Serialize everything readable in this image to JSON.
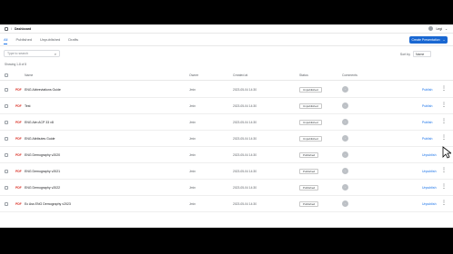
{
  "header": {
    "breadcrumb": [
      "Dashboard"
    ],
    "user_name": "Legi"
  },
  "tabs": [
    {
      "label": "All",
      "active": true
    },
    {
      "label": "Published",
      "active": false
    },
    {
      "label": "Unpublished",
      "active": false
    },
    {
      "label": "Drafts",
      "active": false
    }
  ],
  "create_button": {
    "label": "Create Presentation",
    "icon": "chevron-down-icon"
  },
  "search": {
    "placeholder": "Type to search",
    "icon": "search-icon"
  },
  "sort": {
    "label": "Sort by",
    "value": "Name"
  },
  "showing_text": "Showing 1-8 of 8",
  "table": {
    "columns": [
      "Name",
      "Owner",
      "Created at",
      "Status",
      "Comments"
    ],
    "rows": [
      {
        "tag": "PDF",
        "name": "ENG Abbreviations Guide",
        "owner": "Jmin",
        "date": "2023-05-04 14:30",
        "status": "Unpublished",
        "action": "Publish"
      },
      {
        "tag": "PDF",
        "name": "Test",
        "owner": "Jmin",
        "date": "2023-05-04 14:30",
        "status": "Unpublished",
        "action": "Publish"
      },
      {
        "tag": "PDF",
        "name": "ENG Alm ACP 33 v8",
        "owner": "Jmin",
        "date": "2023-05-04 14:30",
        "status": "Unpublished",
        "action": "Publish"
      },
      {
        "tag": "PDF",
        "name": "ENG Attributes Guide",
        "owner": "Jmin",
        "date": "2023-05-04 14:30",
        "status": "Unpublished",
        "action": "Publish"
      },
      {
        "tag": "PDF",
        "name": "ENG Demography v2020",
        "owner": "Jmin",
        "date": "2023-05-04 14:30",
        "status": "Published",
        "action": "Unpublish"
      },
      {
        "tag": "PDF",
        "name": "ENG Demography v2021",
        "owner": "Jmin",
        "date": "2023-05-04 14:30",
        "status": "Published",
        "action": "Unpublish"
      },
      {
        "tag": "PDF",
        "name": "ENG Demography v2022",
        "owner": "Jmin",
        "date": "2023-05-04 14:30",
        "status": "Published",
        "action": "Unpublish"
      },
      {
        "tag": "PDF",
        "name": "Ec Ass ENG Demography v2023",
        "owner": "Jmin",
        "date": "2023-05-04 14:30",
        "status": "Published",
        "action": "Unpublish"
      }
    ]
  },
  "colors": {
    "accent": "#1967d2",
    "link": "#1a73e8",
    "tag": "#d93025"
  }
}
